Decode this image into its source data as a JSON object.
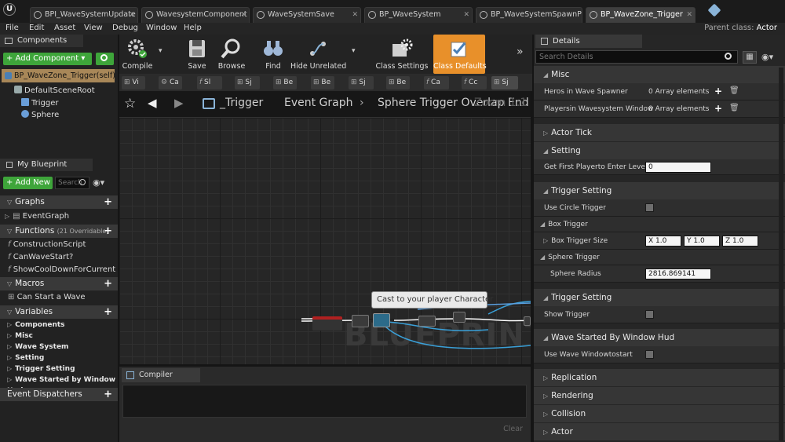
{
  "tabs": [
    {
      "label": "BPI_WaveSystemUpdate"
    },
    {
      "label": "WavesystemComponent"
    },
    {
      "label": "WaveSystemSave"
    },
    {
      "label": "BP_WaveSystem"
    },
    {
      "label": "BP_WaveSystemSpawnP"
    },
    {
      "label": "BP_WaveZone_Trigger"
    }
  ],
  "menu": [
    "File",
    "Edit",
    "Asset",
    "View",
    "Debug",
    "Window",
    "Help"
  ],
  "parent_class": {
    "label": "Parent class:",
    "value": "Actor"
  },
  "components": {
    "title": "Components",
    "add_label": "+ Add Component ▾",
    "self_label": "BP_WaveZone_Trigger(self)",
    "tree": [
      "DefaultSceneRoot",
      "Trigger",
      "Sphere"
    ]
  },
  "my_blueprint": {
    "title": "My Blueprint",
    "add_new_label": "+ Add New ▾",
    "search_placeholder": "Search",
    "graphs_label": "Graphs",
    "graphs": [
      "EventGraph"
    ],
    "functions_label": "Functions",
    "functions_override": "(21 Overridable)",
    "functions": [
      "ConstructionScript",
      "CanWaveStart?",
      "ShowCoolDownForCurrent"
    ],
    "macros_label": "Macros",
    "macros": [
      "Can Start a Wave"
    ],
    "variables_label": "Variables",
    "variable_categories": [
      "Components",
      "Misc",
      "Wave System",
      "Setting",
      "Trigger Setting",
      "Wave Started by Window Hud"
    ],
    "dispatchers_label": "Event Dispatchers"
  },
  "toolbar": {
    "compile": "Compile",
    "save": "Save",
    "browse": "Browse",
    "find": "Find",
    "hide_unrelated": "Hide Unrelated",
    "class_settings": "Class Settings",
    "class_defaults": "Class Defaults"
  },
  "graph_tabs": [
    "Vi",
    "Ca",
    "Sl",
    "Sj",
    "Be",
    "Be",
    "Sj",
    "Be",
    "Ca",
    "Cc",
    "Sj"
  ],
  "breadcrumb": {
    "trigger": "_Trigger",
    "event_graph": "Event Graph",
    "current": "Sphere Trigger Overlap End",
    "zoom": "Zoom 1:1"
  },
  "graph": {
    "watermark": "BLUEPRINT",
    "tooltip": "Cast to your player Character"
  },
  "compiler": {
    "title": "Compiler Results",
    "clear": "Clear"
  },
  "details": {
    "title": "Details",
    "search_placeholder": "Search Details",
    "misc": "Misc",
    "heros_label": "Heros in Wave Spawner",
    "heros_value": "0 Array elements",
    "players_label": "Playersin Wavesystem Window",
    "players_value": "0 Array elements",
    "actor_tick": "Actor Tick",
    "setting": "Setting",
    "first_player_label": "Get First Playerto Enter Levels",
    "first_player_value": "0",
    "trigger_setting": "Trigger Setting",
    "use_circle_label": "Use Circle Trigger",
    "box_trigger": "Box Trigger",
    "box_size_label": "Box Trigger Size",
    "box_x": "X  1.0",
    "box_y": "Y  1.0",
    "box_z": "Z  1.0",
    "sphere_trigger": "Sphere Trigger",
    "sphere_radius_label": "Sphere Radius",
    "sphere_radius_value": "2816.869141",
    "trigger_setting2": "Trigger Setting",
    "show_trigger_label": "Show Trigger",
    "wave_started": "Wave Started By Window Hud",
    "use_wave_label": "Use Wave Windowtostart",
    "replication": "Replication",
    "rendering": "Rendering",
    "collision": "Collision",
    "actor": "Actor"
  },
  "colors": {
    "accent_orange": "#e8902a",
    "green_button": "#3ea53a",
    "selection": "#a88758"
  }
}
